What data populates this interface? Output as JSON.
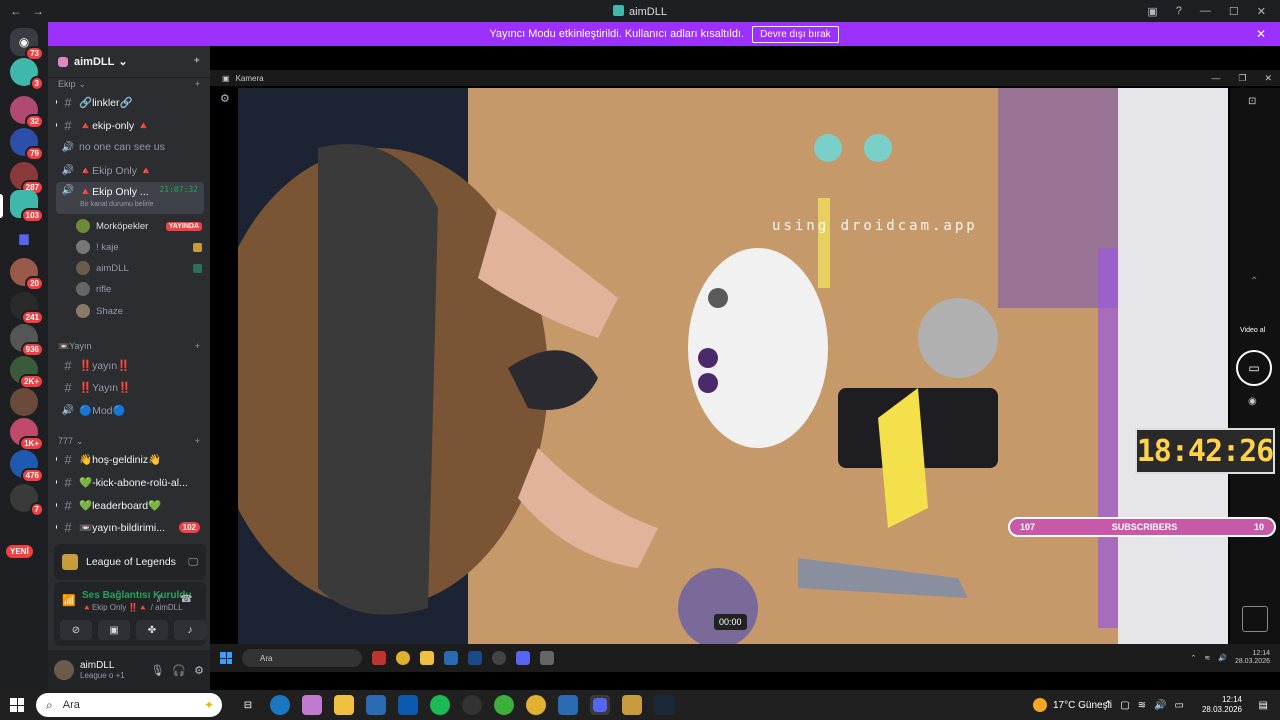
{
  "window": {
    "title": "aimDLL"
  },
  "banner": {
    "message": "Yayıncı Modu etkinleştirildi. Kullanıcı adları kısaltıldı.",
    "button": "Devre dışı bırak"
  },
  "rail": {
    "badges": [
      "73",
      "3",
      "32",
      "79",
      "287",
      "103",
      "20",
      "241",
      "936",
      "2K+",
      "1K+",
      "476",
      "7"
    ],
    "new_label": "YENİ"
  },
  "server": {
    "name": "aimDLL"
  },
  "categories": {
    "ekip": "Ekip",
    "yayin": "Yayın",
    "c777": "777"
  },
  "channels": [
    {
      "icon": "#",
      "label": "🔗linkler🔗"
    },
    {
      "icon": "#",
      "label": "🔺ekip-only 🔺"
    },
    {
      "icon": "🔊",
      "label": "no one can see us"
    },
    {
      "icon": "🔊",
      "label": "🔺Ekip Only 🔺"
    },
    {
      "icon": "🔊",
      "label": "🔺Ekip Only ..."
    }
  ],
  "voice_channel": {
    "timer": "21:07:32",
    "status_hint": "Bir kanal durumu belirle"
  },
  "voice_users": [
    {
      "name": "Morköpekler",
      "badge": "YAYINDA"
    },
    {
      "name": "! kaje"
    },
    {
      "name": "aimDLL"
    },
    {
      "name": "rifle"
    },
    {
      "name": "Shaze"
    }
  ],
  "yayin_channels": [
    {
      "icon": "#",
      "label": "‼️yayın‼️"
    },
    {
      "icon": "#",
      "label": "‼️Yayın‼️"
    },
    {
      "icon": "🔊",
      "label": "🔵Mod🔵"
    }
  ],
  "c777_channels": [
    {
      "icon": "#",
      "label": "👋hoş-geldiniz👋"
    },
    {
      "icon": "#",
      "label": "💚-kick-abone-rolü-al..."
    },
    {
      "icon": "#",
      "label": "💚leaderboard💚"
    },
    {
      "icon": "#",
      "label": "📼yayın-bildirimi...",
      "mention": "102"
    }
  ],
  "activity": {
    "game": "League of Legends"
  },
  "voice_panel": {
    "status": "Ses Bağlantısı Kuruldu",
    "sub": "🔺Ekip Only ‼️🔺 / aimDLL"
  },
  "user": {
    "name": "aimDLL",
    "activity": "League o +1"
  },
  "camera": {
    "title": "Kamera",
    "watermark": "using droidcam.app",
    "video_label": "Video al",
    "elapsed": "00:00"
  },
  "overlay": {
    "timer": "18:42:26",
    "subs_left": "107",
    "subs_label": "SUBSCRIBERS",
    "subs_right": "10"
  },
  "inner_taskbar": {
    "search": "Ara",
    "time": "12:14",
    "date": "28.03.2026"
  },
  "taskbar": {
    "search": "Ara",
    "weather": "17°C  Güneşli",
    "time": "12:14",
    "date": "28.03.2026"
  },
  "colors": {
    "accent": "#9b30ff",
    "danger": "#f23f43",
    "online": "#23a55a",
    "timer": "#ffd24a",
    "subs": "#c759a6"
  }
}
